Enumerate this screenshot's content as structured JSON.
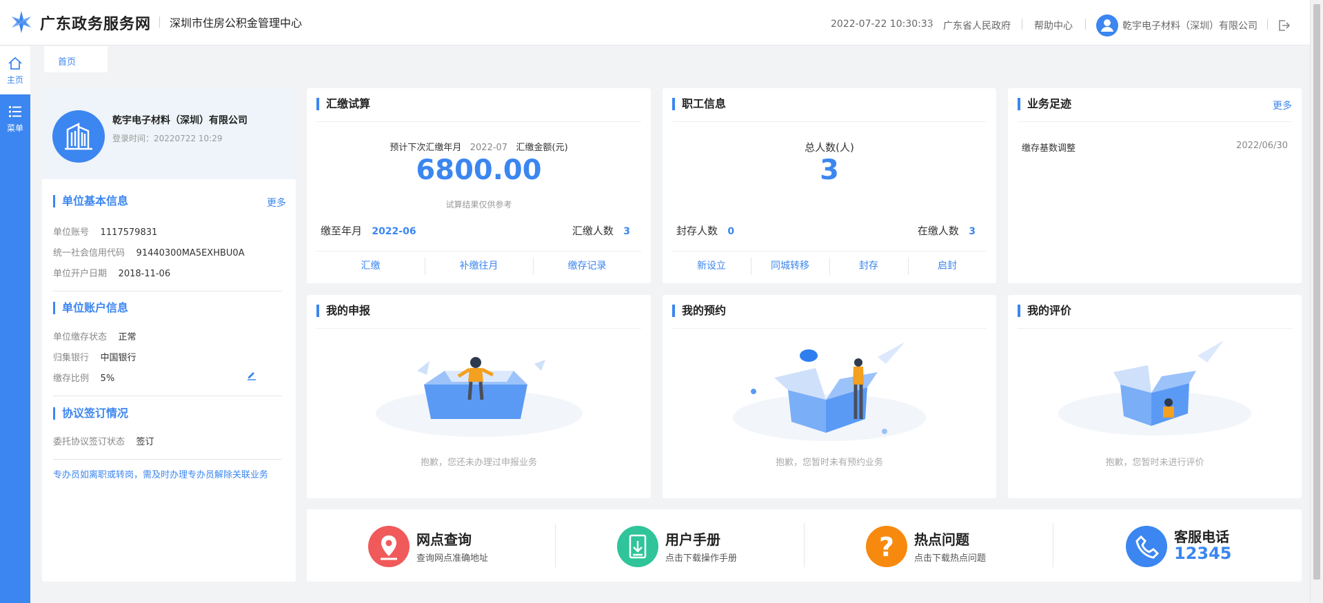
{
  "header": {
    "site_name": "广东政务服务网",
    "center_name": "深圳市住房公积金管理中心",
    "datetime": "2022-07-22 10:30:33",
    "gov_link": "广东省人民政府",
    "help_link": "帮助中心",
    "user_name": "乾宇电子材料（深圳）有限公司"
  },
  "sidebar": {
    "home_label": "主页",
    "menu_label": "菜单"
  },
  "tabs": {
    "home": "首页"
  },
  "company": {
    "name": "乾宇电子材料（深圳）有限公司",
    "login_time": "登录时间：20220722 10:29"
  },
  "basic_info": {
    "title": "单位基本信息",
    "more": "更多",
    "account_label": "单位账号",
    "account_value": "1117579831",
    "credit_label": "统一社会信用代码",
    "credit_value": "91440300MA5EXHBU0A",
    "open_label": "单位开户日期",
    "open_value": "2018-11-06"
  },
  "account_info": {
    "title": "单位账户信息",
    "status_label": "单位缴存状态",
    "status_value": "正常",
    "bank_label": "归集银行",
    "bank_value": "中国银行",
    "ratio_label": "缴存比例",
    "ratio_value": "5%"
  },
  "agreement": {
    "title": "协议签订情况",
    "status_label": "委托协议签订状态",
    "status_value": "签订"
  },
  "notice": "专办员如离职或转岗，需及时办理专办员解除关联业务",
  "calc": {
    "title": "汇缴试算",
    "next_label": "预计下次汇缴年月",
    "next_value": "2022-07",
    "amount_label": "汇缴金额(元)",
    "amount_value": "6800.00",
    "note": "试算结果仅供参考",
    "paid_to_label": "缴至年月",
    "paid_to_value": "2022-06",
    "count_label": "汇缴人数",
    "count_value": "3",
    "actions": [
      "汇缴",
      "补缴往月",
      "缴存记录"
    ]
  },
  "staff": {
    "title": "职工信息",
    "total_label": "总人数(人)",
    "total_value": "3",
    "sealed_label": "封存人数",
    "sealed_value": "0",
    "active_label": "在缴人数",
    "active_value": "3",
    "actions": [
      "新设立",
      "同城转移",
      "封存",
      "启封"
    ]
  },
  "footprint": {
    "title": "业务足迹",
    "more": "更多",
    "item_name": "缴存基数调整",
    "item_date": "2022/06/30"
  },
  "declare": {
    "title": "我的申报",
    "empty": "抱歉，您还未办理过申报业务"
  },
  "appointment": {
    "title": "我的预约",
    "empty": "抱歉，您暂时未有预约业务"
  },
  "evaluation": {
    "title": "我的评价",
    "empty": "抱歉，您暂时未进行评价"
  },
  "bottom": {
    "outlet_title": "网点查询",
    "outlet_sub": "查询网点准确地址",
    "manual_title": "用户手册",
    "manual_sub": "点击下载操作手册",
    "faq_title": "热点问题",
    "faq_sub": "点击下载热点问题",
    "phone_title": "客服电话",
    "phone_number": "12345"
  },
  "colors": {
    "accent": "#3b86f0",
    "outlet": "#f05a5a",
    "manual": "#2fc49a",
    "faq": "#f7890f",
    "phone": "#3b86f0"
  }
}
